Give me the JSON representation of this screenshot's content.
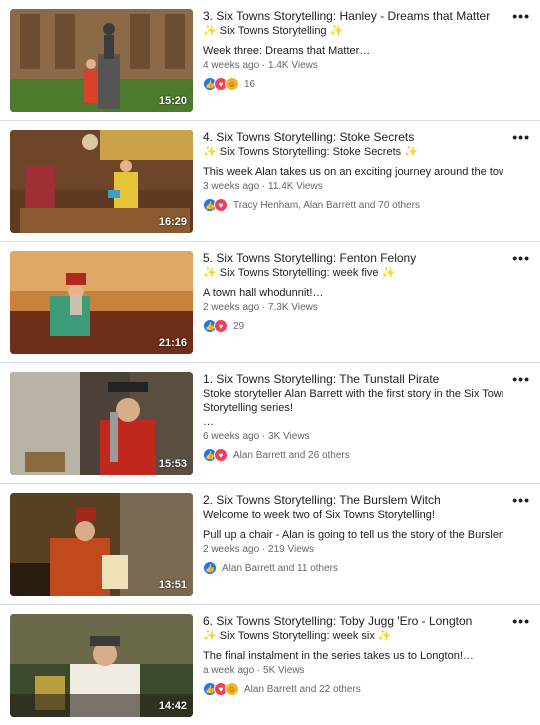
{
  "videos": [
    {
      "title": "3. Six Towns Storytelling: Hanley - Dreams that Matter",
      "subtitle": "Six Towns Storytelling",
      "desc1": "",
      "desc2": "Week three: Dreams that Matter…",
      "meta": "4 weeks ago · 1.4K Views",
      "reactions": "16",
      "duration": "15:20",
      "icons": [
        "like-icon",
        "love-icon",
        "care-icon"
      ]
    },
    {
      "title": "4. Six Towns Storytelling: Stoke Secrets",
      "subtitle": "Six Towns Storytelling: Stoke Secrets",
      "desc1": "",
      "desc2": "This week Alan takes us on an exciting journey around the town,…",
      "meta": "3 weeks ago · 11.4K Views",
      "reactions": "Tracy Henham, Alan Barrett and 70 others",
      "duration": "16:29",
      "icons": [
        "like-icon",
        "love-icon"
      ]
    },
    {
      "title": "5. Six Towns Storytelling: Fenton Felony",
      "subtitle": "Six Towns Storytelling: week five",
      "desc1": "",
      "desc2": "A town hall whodunnit!…",
      "meta": "2 weeks ago · 7.3K Views",
      "reactions": "29",
      "duration": "21:16",
      "icons": [
        "like-icon",
        "love-icon"
      ]
    },
    {
      "title": "1. Six Towns Storytelling: The Tunstall Pirate",
      "subtitle": "Stoke storyteller Alan Barrett with the first story in the Six Towns",
      "desc1": "Storytelling series!",
      "desc2": "…",
      "meta": "6 weeks ago · 3K Views",
      "reactions": "Alan Barrett and 26 others",
      "duration": "15:53",
      "icons": [
        "like-icon",
        "love-icon"
      ]
    },
    {
      "title": "2. Six Towns Storytelling: The Burslem Witch",
      "subtitle": "Welcome to week two of Six Towns Storytelling!",
      "desc1": "",
      "desc2": "Pull up a chair - Alan is going to tell us the story of the Burslem Wit…",
      "meta": "2 weeks ago · 219 Views",
      "reactions": "Alan Barrett and 11 others",
      "duration": "13:51",
      "icons": [
        "like-icon"
      ]
    },
    {
      "title": "6. Six Towns Storytelling: Toby Jugg 'Ero - Longton",
      "subtitle": "Six Towns Storytelling: week six",
      "desc1": "",
      "desc2": "The final instalment in the series takes us to Longton!…",
      "meta": "a week ago · 5K Views",
      "reactions": "Alan Barrett and 22 others",
      "duration": "14:42",
      "icons": [
        "like-icon",
        "love-icon",
        "care-icon"
      ]
    }
  ],
  "sparkle_items": [
    0,
    1,
    2,
    5
  ],
  "colors": {
    "like": "#1877f2",
    "love": "#f33e58",
    "care": "#f7b125",
    "divider": "#dadde1",
    "meta": "#65676b"
  }
}
